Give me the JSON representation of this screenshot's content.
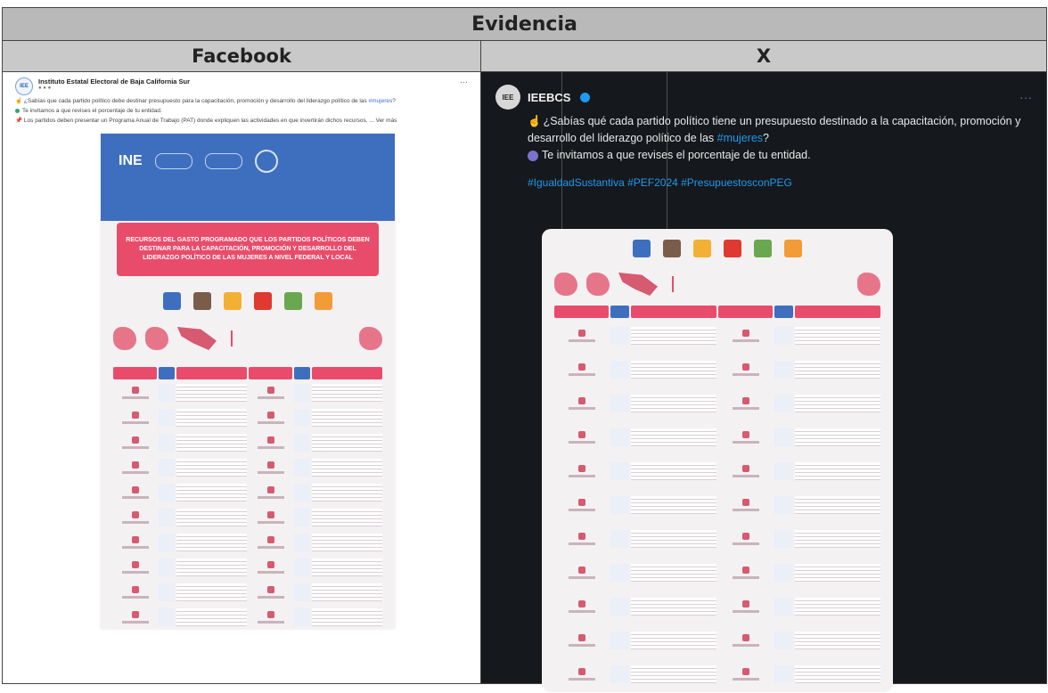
{
  "table": {
    "title": "Evidencia",
    "col_left": "Facebook",
    "col_right": "X"
  },
  "facebook": {
    "account_name": "Instituto Estatal Electoral de Baja California Sur",
    "avatar": "IEE",
    "more": "···",
    "line1": "¿Sabías que cada partido político debe destinar presupuesto para la capacitación, promoción y desarrollo del liderazgo político de las ",
    "line1_tag": "#mujeres",
    "line1_end": "?",
    "line2": "Te invitamos a que revises el porcentaje de tu entidad.",
    "line3": "Los partidos deben presentar un Programa Anual de Trabajo (PAT) donde expliquen las actividades en que invertirán dichos recursos. ... Ver más",
    "image_logo": "INE",
    "image_banner": "RECURSOS DEL GASTO PROGRAMADO QUE LOS PARTIDOS POLÍTICOS DEBEN DESTINAR PARA LA CAPACITACIÓN, PROMOCIÓN Y DESARROLLO DEL LIDERAZGO POLÍTICO DE LAS MUJERES A NIVEL FEDERAL Y LOCAL"
  },
  "x": {
    "account_name": "IEEBCS",
    "avatar": "IEE",
    "more": "···",
    "text1": "¿Sabías qué cada partido político tiene un presupuesto destinado a la capacitación, promoción y desarrollo del liderazgo político de las ",
    "text1_tag": "#mujeres",
    "text1_end": "?",
    "text2": "Te invitamos a que revises el porcentaje de tu entidad.",
    "hashtags": "#IgualdadSustantiva #PEF2024 #PresupuestosconPEG"
  },
  "colors": {
    "header_top": "#b9b9b9",
    "header_col": "#c9c9c9",
    "x_background": "#15181c",
    "infographic_pink": "#e94c6a",
    "infographic_blue": "#3e6fbf",
    "link_blue": "#1d9bf0"
  },
  "party_colors": [
    "#3e6fbf",
    "#7a5c4a",
    "#f2b134",
    "#e0392f",
    "#6aa84f",
    "#f29c38"
  ]
}
